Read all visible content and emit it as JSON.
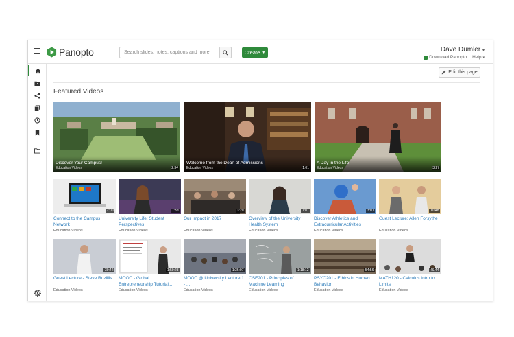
{
  "app": {
    "name": "Panopto"
  },
  "search": {
    "placeholder": "Search slides, notes, captions and more"
  },
  "create": {
    "label": "Create"
  },
  "user": {
    "name": "Dave Dumler",
    "download_label": "Download Panopto",
    "help_label": "Help"
  },
  "edit": {
    "label": "Edit this page"
  },
  "section": {
    "title": "Featured Videos"
  },
  "rail_icons": [
    "home-icon",
    "folder-user-icon",
    "share-icon",
    "playlist-icon",
    "history-icon",
    "bookmark-icon",
    "folder-icon"
  ],
  "featured": [
    {
      "title": "Discover Your Campus!",
      "subtitle": "Education Videos",
      "duration": "2:34"
    },
    {
      "title": "Welcome from the Dean of Admissions",
      "subtitle": "Education Videos",
      "duration": "1:01"
    },
    {
      "title": "A Day in the Life",
      "subtitle": "Education Videos",
      "duration": "3:27"
    }
  ],
  "videos": [
    {
      "title": "Connect to the Campus Network",
      "subtitle": "Education Videos",
      "duration": "2:00"
    },
    {
      "title": "University Life: Student Perspectives",
      "subtitle": "Education Videos",
      "duration": "1:39"
    },
    {
      "title": "Our Impact in 2017",
      "subtitle": "Education Videos",
      "duration": "3:20"
    },
    {
      "title": "Overview of the University Health System",
      "subtitle": "Education Videos",
      "duration": "1:01"
    },
    {
      "title": "Discover Athletics and Extracurricular Activities",
      "subtitle": "Education Videos",
      "duration": "3:01"
    },
    {
      "title": "Guest Lecture: Allen Forsythe",
      "subtitle": "Education Videos",
      "duration": "10:48"
    },
    {
      "title": "Guest Lecture - Steve Rozillis",
      "subtitle": "Education Videos",
      "duration": "39:42"
    },
    {
      "title": "MOOC - Global Entrepreneurship Tutorial...",
      "subtitle": "Education Videos",
      "duration": "1:59:28"
    },
    {
      "title": "MOOC @ University Lecture 1 - ...",
      "subtitle": "Education Videos",
      "duration": "1:36:07"
    },
    {
      "title": "CSE201 - Principles of Machine Learning",
      "subtitle": "Education Videos",
      "duration": "1:18:12"
    },
    {
      "title": "PSYC201 - Ethics in Human Behavior",
      "subtitle": "Education Videos",
      "duration": "54:56"
    },
    {
      "title": "MATH120 - Calculus Intro to Limits",
      "subtitle": "Education Videos",
      "duration": "46:44"
    }
  ],
  "colors": {
    "accent": "#2f8a3b",
    "link": "#2a7ab8"
  }
}
